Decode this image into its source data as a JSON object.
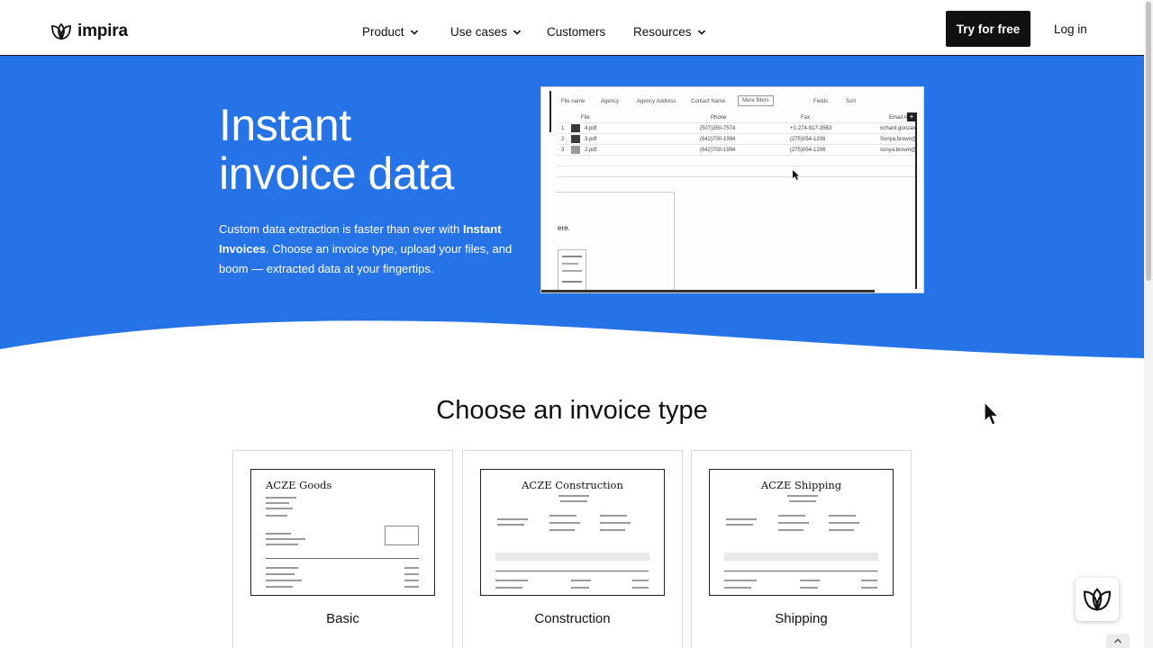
{
  "brand": {
    "name": "impira"
  },
  "nav": {
    "items": [
      {
        "label": "Product",
        "has_dropdown": true
      },
      {
        "label": "Use cases",
        "has_dropdown": true
      },
      {
        "label": "Customers",
        "has_dropdown": false
      },
      {
        "label": "Resources",
        "has_dropdown": true
      }
    ],
    "cta_label": "Try for free",
    "login_label": "Log in"
  },
  "hero": {
    "title_line1": "Instant",
    "title_line2": "invoice data",
    "desc_pre": "Custom data extraction is faster than ever with ",
    "desc_bold": "Instant Invoices",
    "desc_post": ". Choose an invoice type, upload your files, and boom — extracted data at your fingertips.",
    "background_color": "#2673e8"
  },
  "demo": {
    "toolbar": [
      "File name",
      "Agency",
      "Agency Address",
      "Contact Name",
      "More filters",
      "Fields",
      "Sort"
    ],
    "columns": [
      "File",
      "Phone",
      "Fax",
      "Email Ad"
    ],
    "rows": [
      {
        "n": "1",
        "file": "4.pdf",
        "phone": "(507)350-7574",
        "fax": "+1-274-917-3563",
        "email": "richard.gonzale"
      },
      {
        "n": "2",
        "file": "3.pdf",
        "phone": "(642)700-1994",
        "fax": "(275)054-1206",
        "email": "Sonya.brown@"
      },
      {
        "n": "3",
        "file": "2.pdf",
        "phone": "(642)700-1994",
        "fax": "(275)054-1206",
        "email": "sonya.brown@"
      }
    ],
    "panel_text": "ere."
  },
  "invoices": {
    "title": "Choose an invoice type",
    "cards": [
      {
        "label": "Basic",
        "company": "ACZE Goods"
      },
      {
        "label": "Construction",
        "company": "ACZE Construction"
      },
      {
        "label": "Shipping",
        "company": "ACZE Shipping"
      }
    ]
  }
}
